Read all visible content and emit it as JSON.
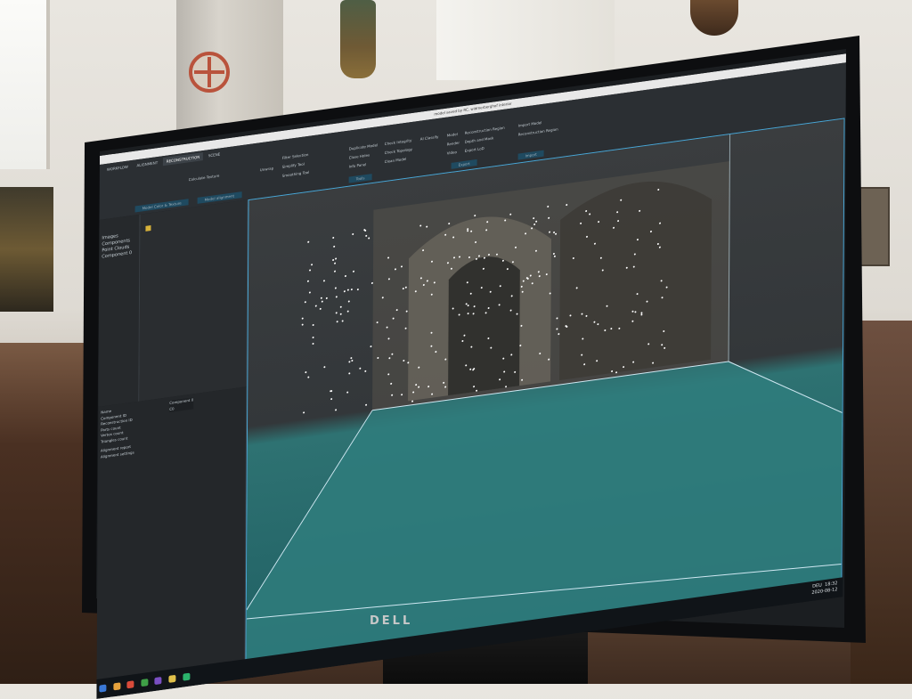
{
  "window": {
    "title": "model saved by RC, widmerberghof interior"
  },
  "ribbon": {
    "tabs": [
      "WORKFLOW",
      "ALIGNMENT",
      "RECONSTRUCTION",
      "SCENE"
    ],
    "items": [
      "Filter Selection",
      "Unwrap",
      "Calculate Texture",
      "Simplify Tool",
      "Smoothing Tool",
      "Duplicate Model",
      "Close Holes",
      "Check Integrity",
      "Check Topology",
      "Clean Model",
      "AI Classify",
      "Info Panel",
      "Model",
      "Render",
      "Video",
      "Reconstruction Region",
      "Depth and Mask",
      "Export LoD",
      "Import Model",
      "Reconstruction Region"
    ],
    "groups": [
      "Model Color & Texture",
      "Model alignment",
      "Tools",
      "Export",
      "Import"
    ]
  },
  "panels": {
    "tree_items": [
      "Images",
      "Components",
      "Point Clouds",
      "Component 0"
    ],
    "properties": [
      "Name",
      "Component ID",
      "Reconstruction ID",
      "Parts count",
      "Vertex count",
      "Triangles count"
    ],
    "property_values": [
      "Component 0",
      "C0"
    ],
    "sections": [
      "Alignment report",
      "Alignment settings"
    ]
  },
  "taskbar": {
    "language": "DEU",
    "time": "18:32",
    "date": "2020-08-12"
  },
  "brand": "DELL",
  "colors": {
    "viewport_floor": "#2e7272",
    "selection_box": "#4aa7d6",
    "ribbon_bg": "#2b2f33"
  }
}
